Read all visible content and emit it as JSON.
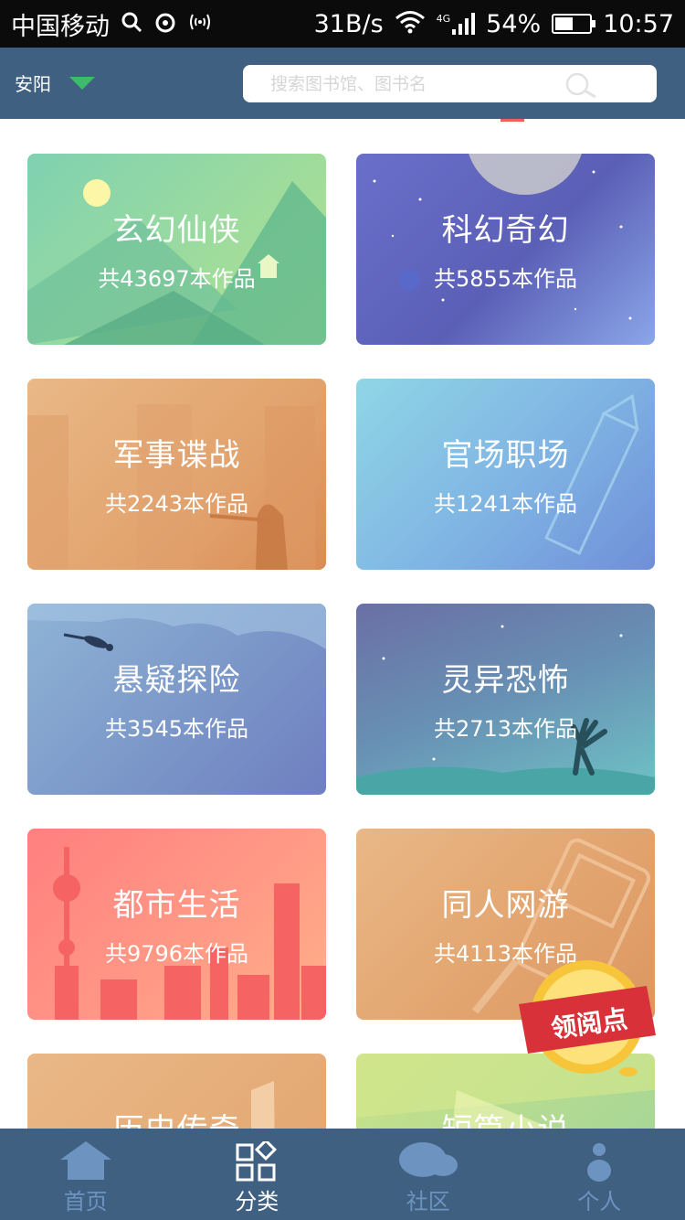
{
  "status_bar": {
    "carrier": "中国移动",
    "speed": "31B/s",
    "network": "4G",
    "battery": "54%",
    "battery_level": 0.54,
    "time": "10:57"
  },
  "header": {
    "city": "安阳",
    "search_placeholder": "搜索图书馆、图书名"
  },
  "categories": [
    {
      "title": "玄幻仙侠",
      "count": "共43697本作品"
    },
    {
      "title": "科幻奇幻",
      "count": "共5855本作品"
    },
    {
      "title": "军事谍战",
      "count": "共2243本作品"
    },
    {
      "title": "官场职场",
      "count": "共1241本作品"
    },
    {
      "title": "悬疑探险",
      "count": "共3545本作品"
    },
    {
      "title": "灵异恐怖",
      "count": "共2713本作品"
    },
    {
      "title": "都市生活",
      "count": "共9796本作品"
    },
    {
      "title": "同人网游",
      "count": "共4113本作品"
    },
    {
      "title": "历史传奇",
      "count": ""
    },
    {
      "title": "短篇小说",
      "count": ""
    }
  ],
  "reward": {
    "label": "领阅点"
  },
  "tabs": [
    {
      "label": "首页",
      "icon": "home-icon"
    },
    {
      "label": "分类",
      "icon": "category-icon"
    },
    {
      "label": "社区",
      "icon": "cloud-icon"
    },
    {
      "label": "个人",
      "icon": "person-icon"
    }
  ],
  "colors": {
    "header": "#3f6080",
    "accent": "#3dbb6c",
    "tab_inactive": "#6d93c1",
    "tab_active": "#ffffff"
  }
}
